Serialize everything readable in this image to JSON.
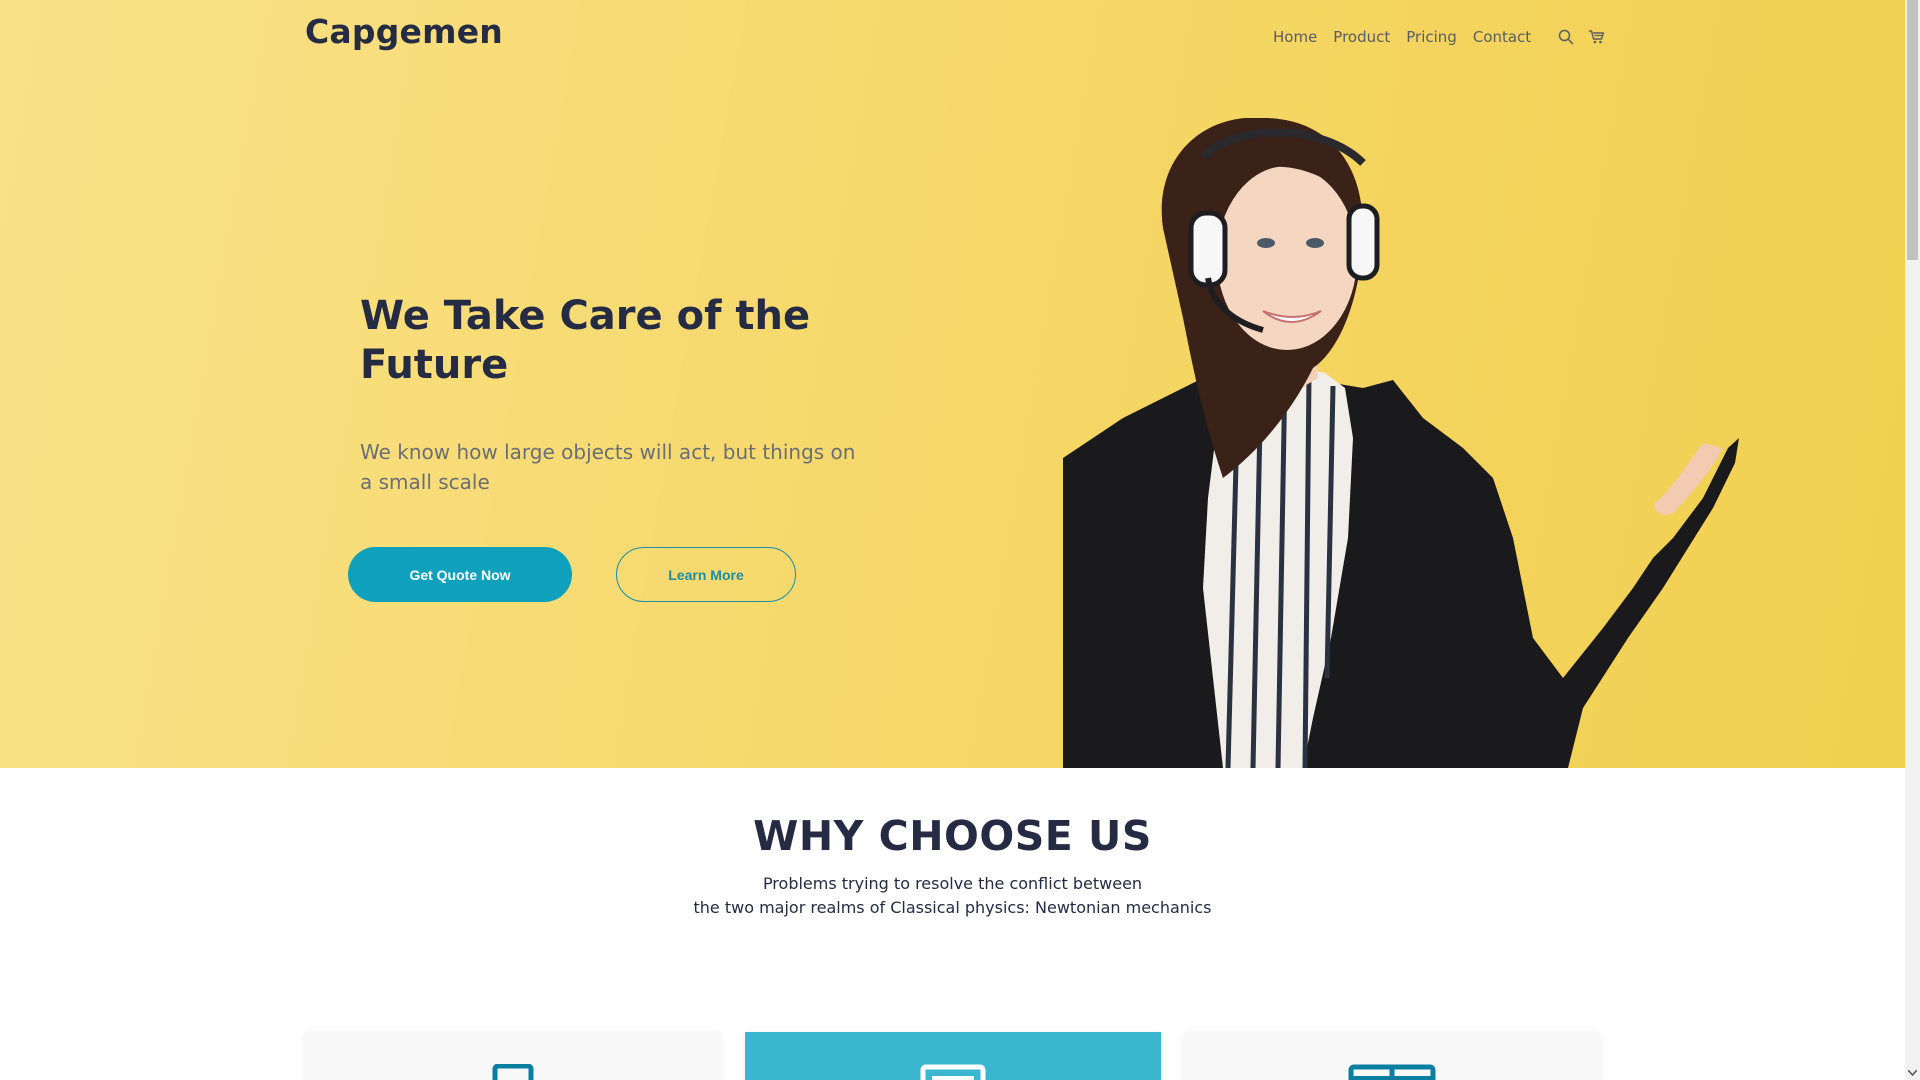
{
  "brand": {
    "name": "Capgemen"
  },
  "nav": {
    "items": [
      {
        "label": "Home"
      },
      {
        "label": "Product"
      },
      {
        "label": "Pricing"
      },
      {
        "label": "Contact"
      }
    ],
    "icons": [
      "search-icon",
      "cart-icon"
    ]
  },
  "hero": {
    "title": "We Take Care of the Future",
    "subtitle": "We know how large objects will act, but things on a small scale",
    "primary_button": "Get Quote Now",
    "secondary_button": "Learn More",
    "colors": {
      "background": "#f6d96c",
      "accent": "#0fa1bc"
    }
  },
  "why": {
    "title": "WHY CHOOSE US",
    "line1": "Problems trying to resolve the conflict between",
    "line2": "the two major realms of Classical physics: Newtonian mechanics"
  },
  "cards": {
    "icons": [
      "briefcase-icon",
      "document-icon",
      "layout-icon"
    ],
    "highlight_color": "#3bb6d1"
  }
}
